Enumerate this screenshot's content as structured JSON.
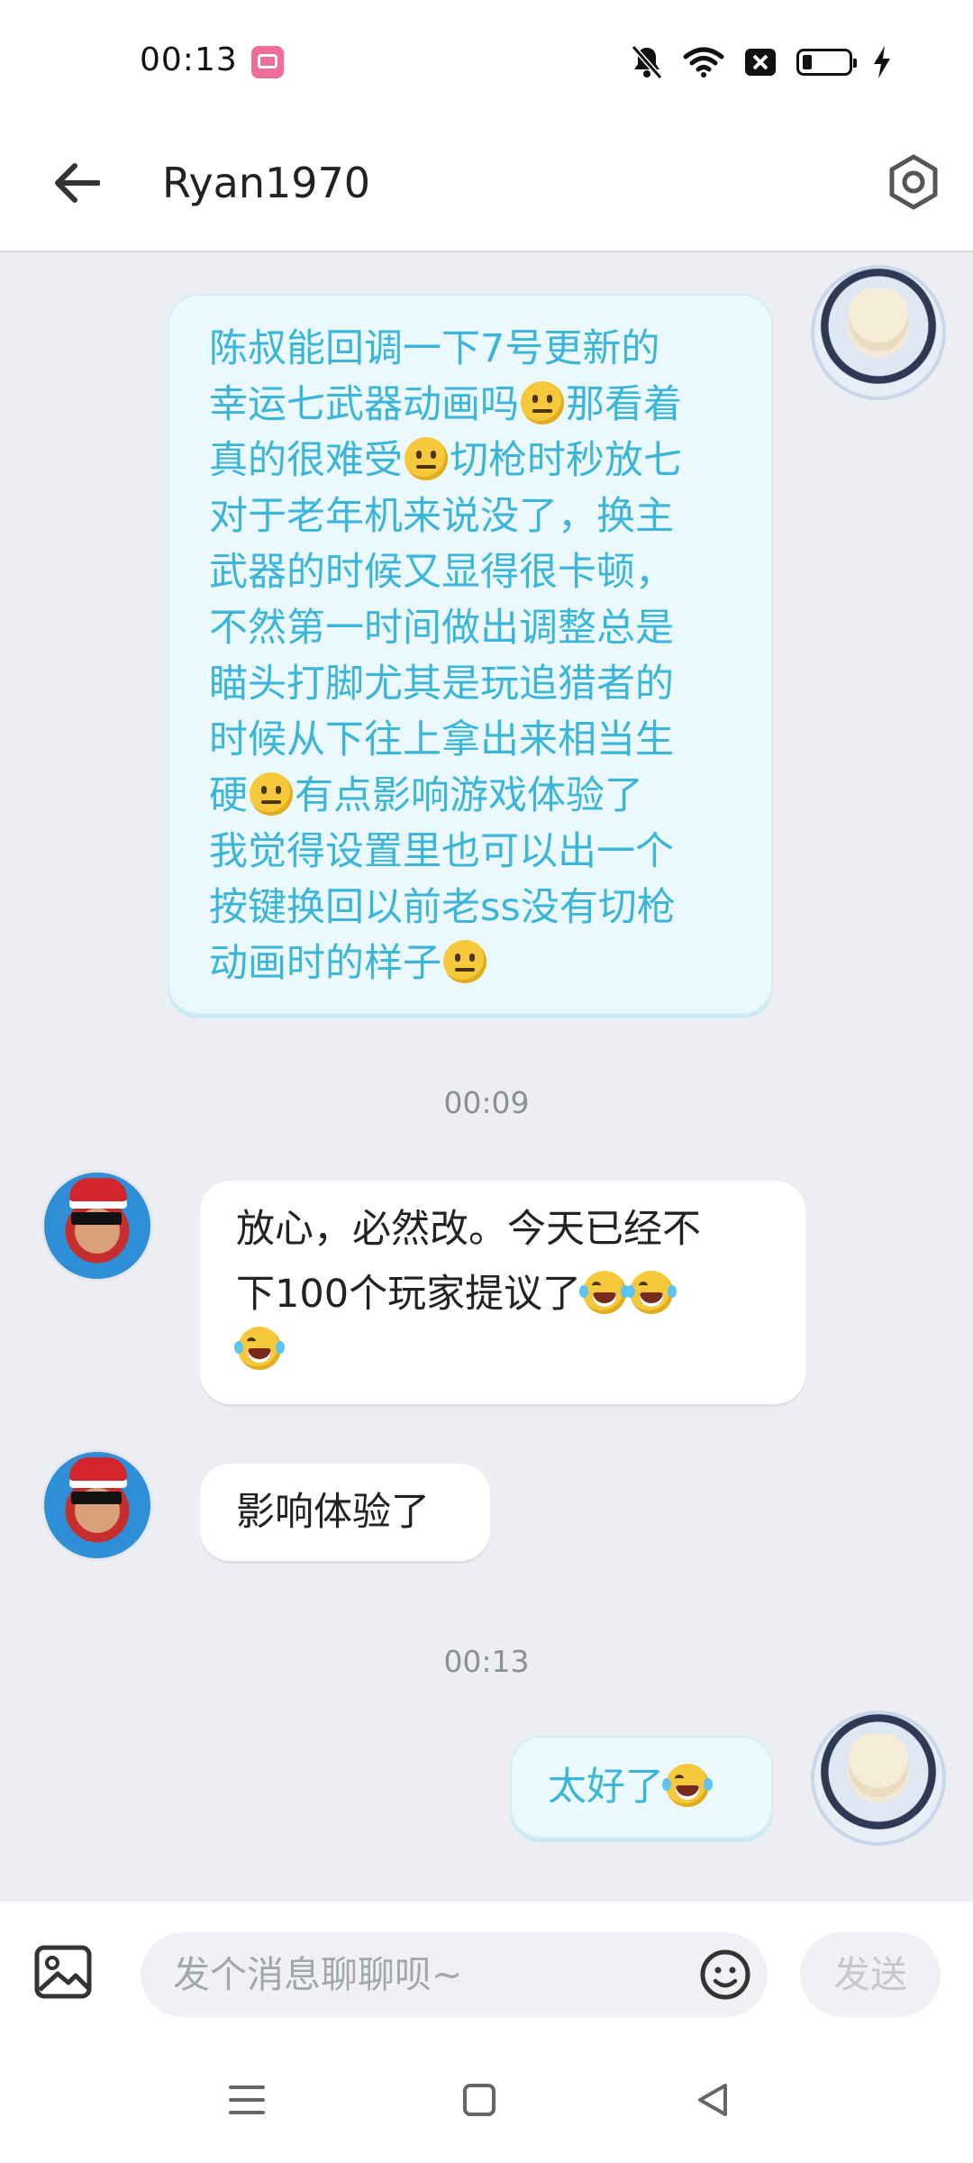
{
  "status_bar": {
    "time": "00:13",
    "app_icon": "bilibili-icon",
    "icons": [
      "mute-bell-icon",
      "wifi-icon",
      "sim-off-icon",
      "battery-icon",
      "charging-icon"
    ]
  },
  "header": {
    "title": "Ryan1970",
    "back_icon": "arrow-left-icon",
    "settings_icon": "hexagon-settings-icon"
  },
  "messages": [
    {
      "direction": "sent",
      "lines": [
        "陈叔能回调一下7号更新的",
        "幸运七武器动画吗",
        "那看着",
        "真的很难受",
        "切枪时秒放七",
        "对于老年机来说没了，换主",
        "武器的时候又显得很卡顿，",
        "不然第一时间做出调整总是",
        "瞄头打脚尤其是玩追猎者的",
        "时候从下往上拿出来相当生",
        "硬",
        "有点影响游戏体验了",
        "我觉得设置里也可以出一个",
        "按键换回以前老ss没有切枪",
        "动画时的样子"
      ]
    },
    {
      "timestamp": "00:09"
    },
    {
      "direction": "received",
      "lines": [
        "放心，必然改。今天已经不",
        "下100个玩家提议了"
      ]
    },
    {
      "direction": "received",
      "text": "影响体验了"
    },
    {
      "timestamp": "00:13"
    },
    {
      "direction": "sent",
      "text": "太好了"
    }
  ],
  "composer": {
    "placeholder": "发个消息聊聊呗~",
    "send_label": "发送",
    "image_icon": "image-icon",
    "emoji_icon": "emoji-smile-icon"
  },
  "nav": [
    "menu-icon",
    "home-square-icon",
    "back-triangle-icon"
  ]
}
